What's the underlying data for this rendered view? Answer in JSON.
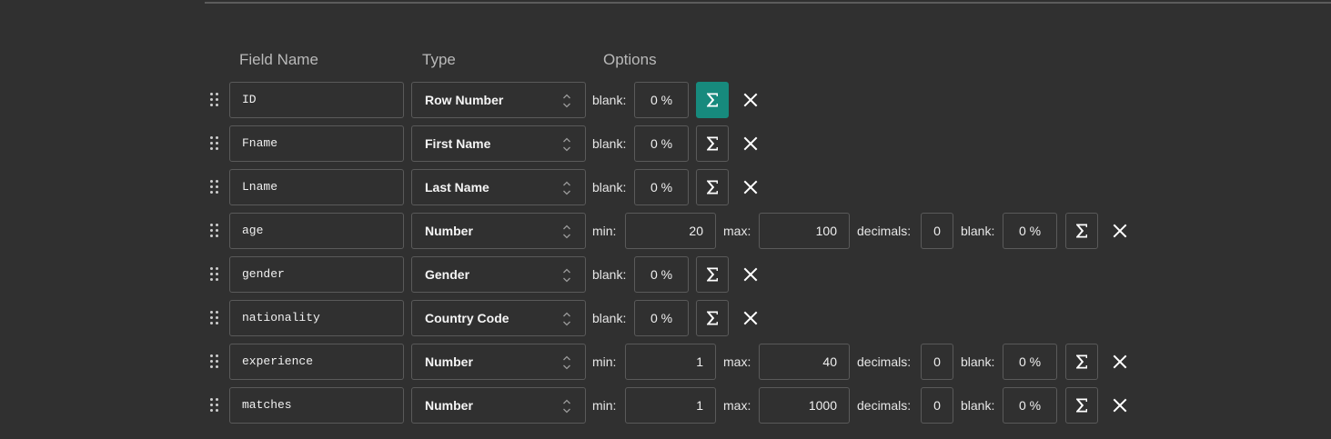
{
  "headers": {
    "field_name": "Field Name",
    "type": "Type",
    "options": "Options"
  },
  "labels": {
    "blank": "blank:",
    "min": "min:",
    "max": "max:",
    "decimals": "decimals:"
  },
  "rows": [
    {
      "name": "ID",
      "type": "Row Number",
      "options": {
        "blank": "0 %"
      },
      "sigma_active": true
    },
    {
      "name": "Fname",
      "type": "First Name",
      "options": {
        "blank": "0 %"
      }
    },
    {
      "name": "Lname",
      "type": "Last Name",
      "options": {
        "blank": "0 %"
      }
    },
    {
      "name": "age",
      "type": "Number",
      "options": {
        "min": "20",
        "max": "100",
        "decimals": "0",
        "blank": "0 %"
      }
    },
    {
      "name": "gender",
      "type": "Gender",
      "options": {
        "blank": "0 %"
      }
    },
    {
      "name": "nationality",
      "type": "Country Code",
      "options": {
        "blank": "0 %"
      }
    },
    {
      "name": "experience",
      "type": "Number",
      "options": {
        "min": "1",
        "max": "40",
        "decimals": "0",
        "blank": "0 %"
      }
    },
    {
      "name": "matches",
      "type": "Number",
      "options": {
        "min": "1",
        "max": "1000",
        "decimals": "0",
        "blank": "0 %"
      }
    }
  ],
  "icons": {
    "drag": "drag-handle-icon",
    "sigma": "sigma-icon",
    "remove": "close-icon",
    "select": "select-arrows-icon"
  },
  "colors": {
    "background": "#303030",
    "accent": "#178a7d",
    "border": "#5a5a5a"
  }
}
